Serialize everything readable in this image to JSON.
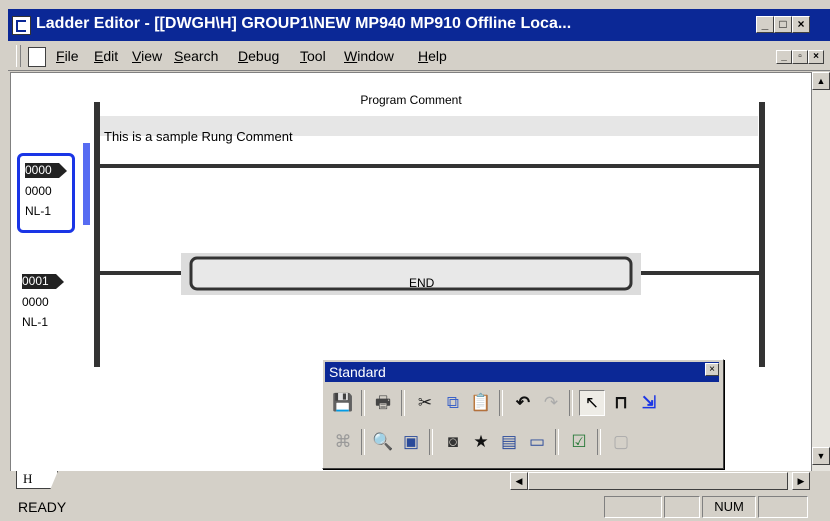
{
  "window": {
    "title": "Ladder Editor - [[DWGH\\H]    GROUP1\\NEW  MP940  MP910     Offline  Loca..."
  },
  "menu": {
    "items": [
      {
        "label": "File"
      },
      {
        "label": "Edit"
      },
      {
        "label": "View"
      },
      {
        "label": "Search"
      },
      {
        "label": "Debug"
      },
      {
        "label": "Tool"
      },
      {
        "label": "Window"
      },
      {
        "label": "Help"
      }
    ]
  },
  "ladder": {
    "program_comment": "Program Comment",
    "rung_comment": "This is a sample Rung Comment",
    "rungs": [
      {
        "number": "0000",
        "step": "0000",
        "nest": "NL-1",
        "selected": true
      },
      {
        "number": "0001",
        "step": "0000",
        "nest": "NL-1",
        "selected": false
      }
    ],
    "end_instruction": "END"
  },
  "sheet_tab": {
    "label": "H"
  },
  "toolbar": {
    "title": "Standard",
    "close_label": "×",
    "row1": [
      {
        "icon": "save-icon",
        "glyph": "💾"
      },
      {
        "icon": "print-icon",
        "glyph": "🖶"
      },
      {
        "icon": "cut-icon",
        "glyph": "✂"
      },
      {
        "icon": "copy-icon",
        "glyph": "⧉"
      },
      {
        "icon": "paste-icon",
        "glyph": "📋"
      },
      {
        "icon": "undo-icon",
        "glyph": "↶"
      },
      {
        "icon": "redo-icon",
        "glyph": "↷"
      },
      {
        "icon": "pointer-icon",
        "glyph": "↖"
      },
      {
        "icon": "coil-icon",
        "glyph": "⊓"
      },
      {
        "icon": "insert-row-icon",
        "glyph": "⇲"
      }
    ],
    "row2": [
      {
        "icon": "debug-icon",
        "glyph": "⌘"
      },
      {
        "icon": "find-icon",
        "glyph": "🔍"
      },
      {
        "icon": "monitor-icon",
        "glyph": "▣"
      },
      {
        "icon": "register-icon",
        "glyph": "◙"
      },
      {
        "icon": "favorite-icon",
        "glyph": "★"
      },
      {
        "icon": "list-icon",
        "glyph": "▤"
      },
      {
        "icon": "window-icon",
        "glyph": "▭"
      },
      {
        "icon": "check-icon",
        "glyph": "☑"
      },
      {
        "icon": "disabled-icon",
        "glyph": "▢"
      }
    ]
  },
  "status": {
    "text": "READY",
    "indicator": "NUM"
  },
  "colors": {
    "title_bar": "#0b2896",
    "selection": "#1a35e6",
    "rung_comment_bg": "#e6e6e6"
  }
}
